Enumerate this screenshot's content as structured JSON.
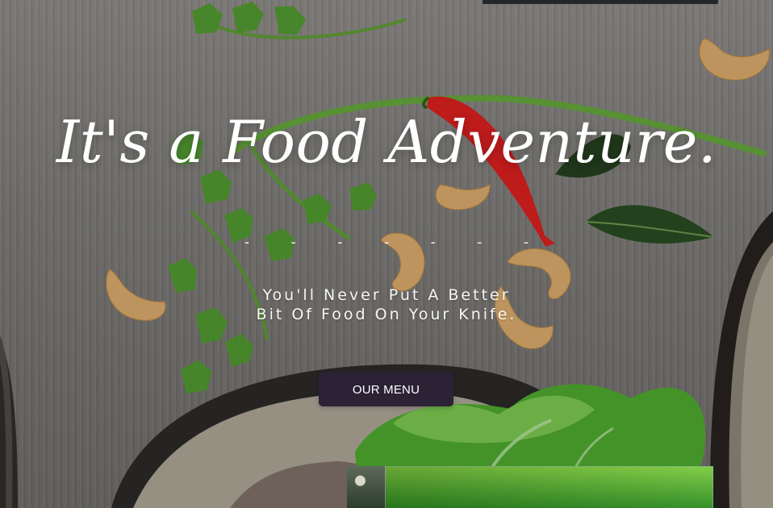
{
  "hero": {
    "title": "It's a Food Adventure.",
    "dots": "- - - - - - -",
    "subtitle_line_1": "You'll Never Put A Better",
    "subtitle_line_2": "Bit Of Food On Your Knife."
  },
  "cta": {
    "menu_label": "OUR MENU"
  },
  "colors": {
    "button_bg": "#2b2236",
    "text": "#ffffff",
    "top_bar": "#2b2c31"
  }
}
